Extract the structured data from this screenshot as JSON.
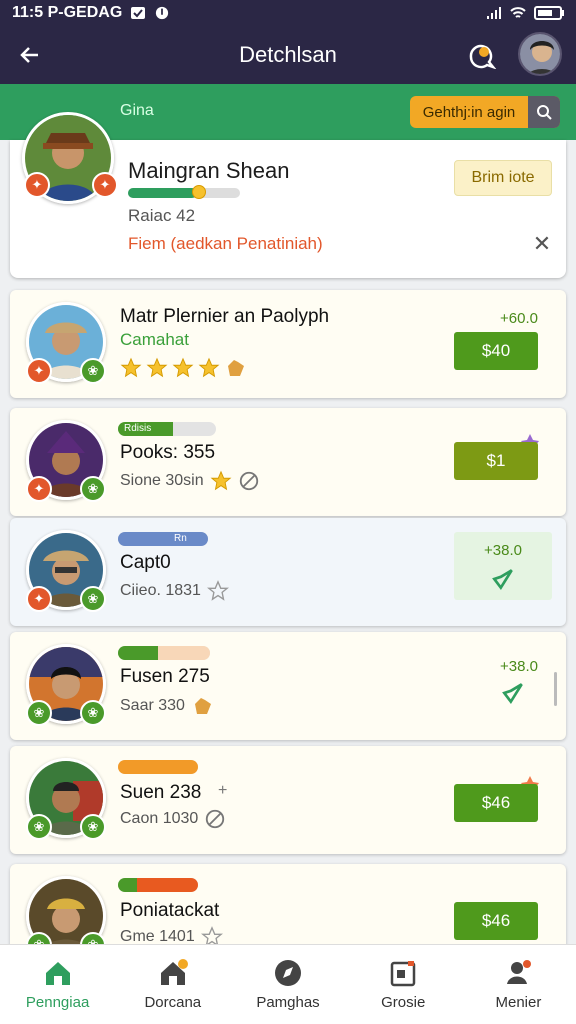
{
  "status_bar": {
    "left_text": "11:5 P-GEDAG",
    "right_battery": ""
  },
  "app_bar": {
    "title": "Detchlsan"
  },
  "green_bar": {
    "label": "Gina",
    "search_text": "Gehthj:in agin"
  },
  "profile": {
    "name": "Maingran Shean",
    "sub": "Raiac 42",
    "link": "Fiem (aedkan Penatiniah)",
    "button": "Brim iote",
    "progress": 0.62
  },
  "list": [
    {
      "title": "Matr Plernier an Paolyph",
      "subtitle": "Camahat",
      "top_right": "+60.0",
      "price": "$40",
      "rating": 4
    },
    {
      "bar_label": "Rdisis",
      "title": "Pooks: 355",
      "sub": "Sione 30sin",
      "price": "$1"
    },
    {
      "bar_label": "Rn",
      "title": "Capt0",
      "sub": "Ciieo. 1831",
      "top_right": "+38.0"
    },
    {
      "title": "Fusen 275",
      "sub": "Saar 330",
      "top_right": "+38.0"
    },
    {
      "title": "Suen 238",
      "sub": "Caon 1030",
      "price": "$46"
    },
    {
      "title": "Poniatackat",
      "sub": "Gme 1401",
      "price": "$46"
    }
  ],
  "tabs": [
    {
      "label": "Penngiaa",
      "icon": "home-icon"
    },
    {
      "label": "Dorcana",
      "icon": "house-badge-icon"
    },
    {
      "label": "Pamghas",
      "icon": "compass-icon"
    },
    {
      "label": "Grosie",
      "icon": "calendar-icon"
    },
    {
      "label": "Menier",
      "icon": "profile-pin-icon"
    }
  ],
  "colors": {
    "header": "#2b2745",
    "green": "#2e9e5e",
    "accent": "#f2a825",
    "price": "#4f9a1c"
  }
}
